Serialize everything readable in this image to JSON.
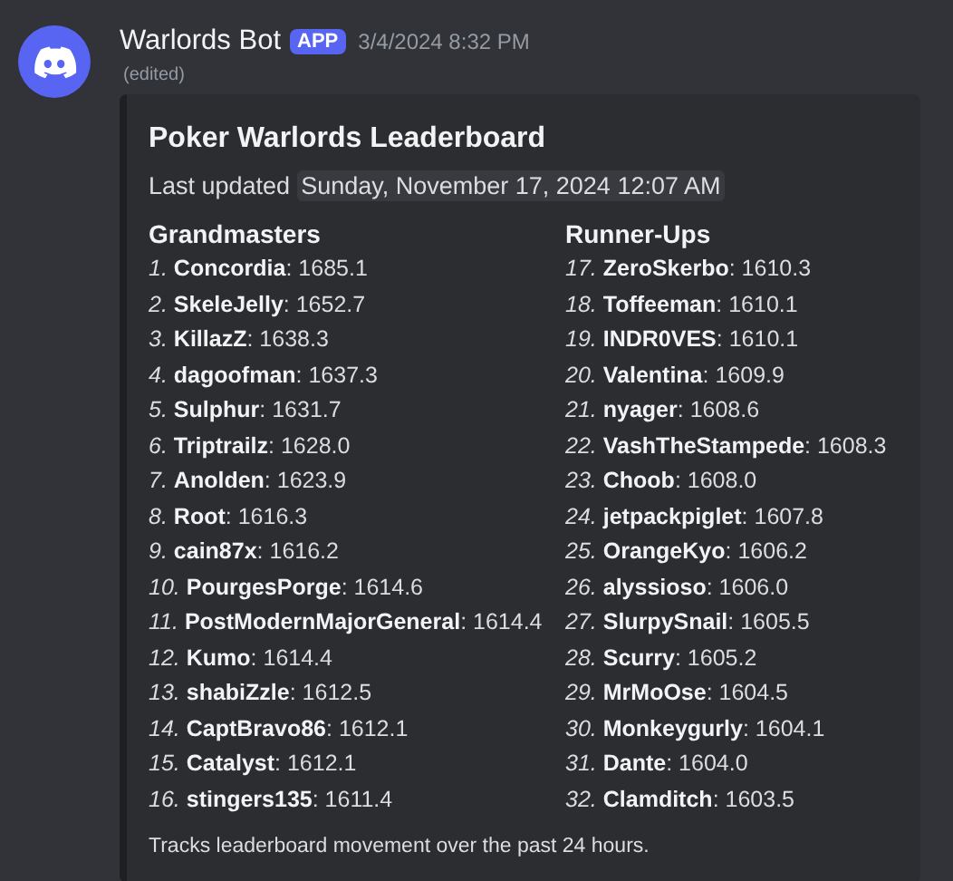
{
  "message": {
    "author": "Warlords Bot",
    "badge": "APP",
    "timestamp": "3/4/2024 8:32 PM",
    "edited": "(edited)"
  },
  "embed": {
    "title": "Poker Warlords Leaderboard",
    "updated_label": "Last updated",
    "updated_value": "Sunday, November 17, 2024 12:07 AM",
    "fields": [
      {
        "name": "Grandmasters",
        "lines": [
          "*1.* **Concordia**: 1685.1",
          "*2.* **SkeleJelly**: 1652.7",
          "*3.* **KillazZ**: 1638.3",
          "*4.* **dagoofman**: 1637.3",
          "*5.* **Sulphur**: 1631.7",
          "*6.* **Triptrailz**: 1628.0",
          "*7.* **Anolden**: 1623.9",
          "*8.* **Root**: 1616.3",
          "*9.* **cain87x**: 1616.2",
          "*10.* **PourgesPorge**: 1614.6",
          "*11.* **PostModernMajorGeneral**: 1614.4",
          "*12.* **Kumo**: 1614.4",
          "*13.* **shabiZzle**: 1612.5",
          "*14.* **CaptBravo86**: 1612.1",
          "*15.* **Catalyst**: 1612.1",
          "*16.* **stingers135**: 1611.4"
        ]
      },
      {
        "name": "Runner-Ups",
        "lines": [
          "*17.* **ZeroSkerbo**: 1610.3",
          "*18.* **Toffeeman**: 1610.1",
          "*19.* **INDR0VES**: 1610.1",
          "*20.* **Valentina**: 1609.9",
          "*21.* **nyager**: 1608.6",
          "*22.* **VashTheStampede**: 1608.3",
          "*23.* **Choob**: 1608.0",
          "*24.* **jetpackpiglet**: 1607.8",
          "*25.* **OrangeKyo**: 1606.2",
          "*26.* **alyssioso**: 1606.0",
          "*27.* **SlurpySnail**: 1605.5",
          "*28.* **Scurry**: 1605.2",
          "*29.* **MrMoOse**: 1604.5",
          "*30.* **Monkeygurly**: 1604.1",
          "*31.* **Dante**: 1604.0",
          "*32.* **Clamditch**: 1603.5"
        ]
      }
    ],
    "footer": "Tracks leaderboard movement over the past 24 hours."
  }
}
